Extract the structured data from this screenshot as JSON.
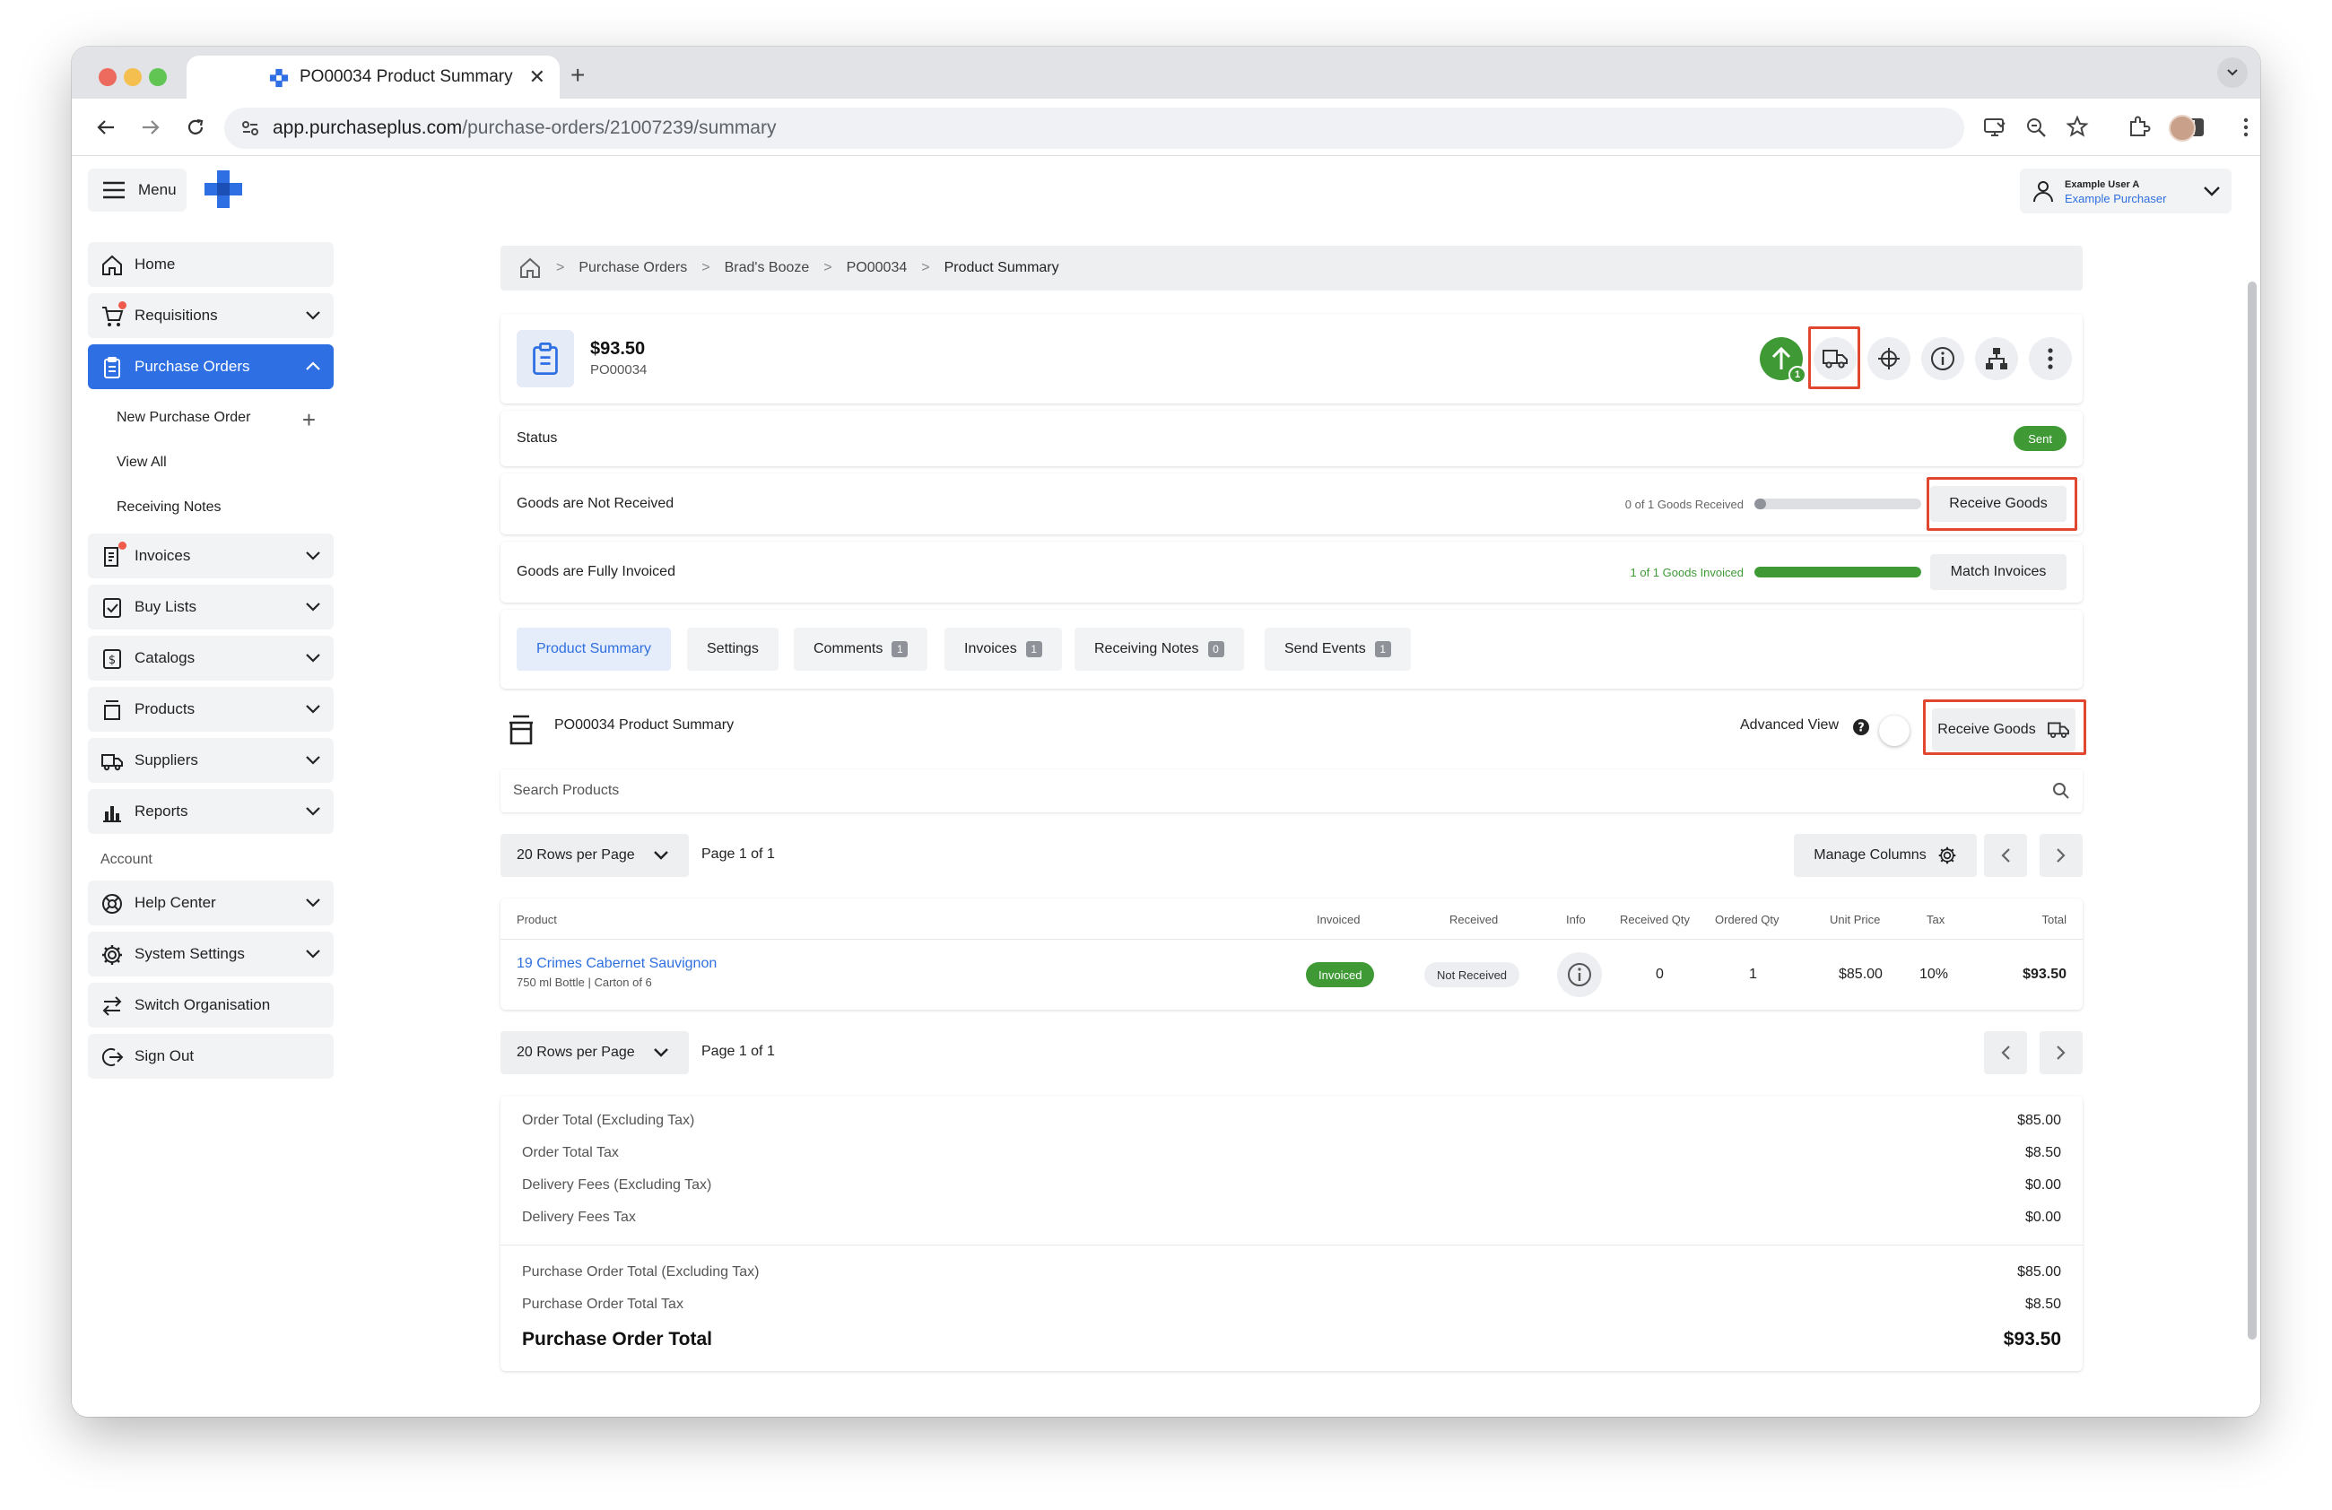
{
  "browser": {
    "tab_title": "PO00034 Product Summary",
    "tab_close": "✕",
    "new_tab": "+",
    "url_host": "app.purchaseplus.com",
    "url_path": "/purchase-orders/21007239/summary"
  },
  "header": {
    "menu_label": "Menu",
    "user_name": "Example User A",
    "user_role": "Example Purchaser"
  },
  "sidebar": {
    "items": [
      {
        "label": "Home",
        "icon": "home-icon"
      },
      {
        "label": "Requisitions",
        "icon": "cart-icon"
      },
      {
        "label": "Purchase Orders",
        "icon": "clipboard-icon"
      },
      {
        "label": "Invoices",
        "icon": "invoice-icon"
      },
      {
        "label": "Buy Lists",
        "icon": "checklist-icon"
      },
      {
        "label": "Catalogs",
        "icon": "catalog-icon"
      },
      {
        "label": "Products",
        "icon": "products-icon"
      },
      {
        "label": "Suppliers",
        "icon": "truck-icon"
      },
      {
        "label": "Reports",
        "icon": "bar-chart-icon"
      }
    ],
    "sub_items": [
      "New Purchase Order",
      "View All",
      "Receiving Notes"
    ],
    "account_heading": "Account",
    "account_items": [
      {
        "label": "Help Center",
        "icon": "lifebuoy-icon"
      },
      {
        "label": "System Settings",
        "icon": "gear-icon"
      },
      {
        "label": "Switch Organisation",
        "icon": "switch-icon"
      },
      {
        "label": "Sign Out",
        "icon": "sign-out-icon"
      }
    ]
  },
  "breadcrumb": [
    "Purchase Orders",
    "Brad's Booze",
    "PO00034",
    "Product Summary"
  ],
  "po": {
    "amount": "$93.50",
    "number": "PO00034",
    "send_badge": "1"
  },
  "status": {
    "label": "Status",
    "value": "Sent",
    "color": "#3f9a36"
  },
  "receiving": {
    "label": "Goods are Not Received",
    "progress_text": "0 of 1 Goods Received",
    "progress_fraction": 0,
    "button": "Receive Goods"
  },
  "invoicing": {
    "label": "Goods are Fully Invoiced",
    "progress_text": "1 of 1 Goods Invoiced",
    "progress_fraction": 1,
    "button": "Match Invoices"
  },
  "tabs": [
    {
      "label": "Product Summary",
      "count": ""
    },
    {
      "label": "Settings",
      "count": ""
    },
    {
      "label": "Comments",
      "count": "1"
    },
    {
      "label": "Invoices",
      "count": "1"
    },
    {
      "label": "Receiving Notes",
      "count": "0"
    },
    {
      "label": "Send Events",
      "count": "1"
    }
  ],
  "summary": {
    "title": "PO00034 Product Summary",
    "advanced_view": "Advanced View",
    "receive_button": "Receive Goods",
    "search_placeholder": "Search Products",
    "rows_per_page": "20 Rows per Page",
    "page_info": "Page 1 of 1",
    "manage_columns": "Manage Columns"
  },
  "table": {
    "headers": [
      "Product",
      "Invoiced",
      "Received",
      "Info",
      "Received Qty",
      "Ordered Qty",
      "Unit Price",
      "Tax",
      "Total"
    ],
    "rows": [
      {
        "product": "19 Crimes Cabernet Sauvignon",
        "detail": "750 ml Bottle | Carton of 6",
        "invoiced": "Invoiced",
        "received": "Not Received",
        "received_qty": "0",
        "ordered_qty": "1",
        "unit_price": "$85.00",
        "tax": "10%",
        "total": "$93.50"
      }
    ]
  },
  "totals": {
    "group1": [
      {
        "label": "Order Total (Excluding Tax)",
        "value": "$85.00"
      },
      {
        "label": "Order Total Tax",
        "value": "$8.50"
      },
      {
        "label": "Delivery Fees (Excluding Tax)",
        "value": "$0.00"
      },
      {
        "label": "Delivery Fees Tax",
        "value": "$0.00"
      }
    ],
    "group2": [
      {
        "label": "Purchase Order Total (Excluding Tax)",
        "value": "$85.00"
      },
      {
        "label": "Purchase Order Total Tax",
        "value": "$8.50"
      }
    ],
    "grand": {
      "label": "Purchase Order Total",
      "value": "$93.50"
    }
  },
  "colors": {
    "accent": "#2e6fe3",
    "success": "#3f9a36",
    "highlight": "#e1462f"
  }
}
